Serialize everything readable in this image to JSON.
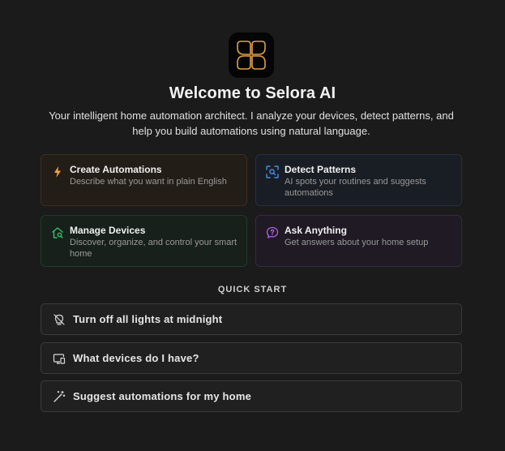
{
  "header": {
    "logo_icon": "flower-logo-icon",
    "title": "Welcome to Selora AI",
    "subtitle": "Your intelligent home automation architect. I analyze your devices, detect patterns, and help you build automations using natural language."
  },
  "features": [
    {
      "icon": "lightning-icon",
      "title": "Create Automations",
      "description": "Describe what you want in plain English",
      "accent": "#f0a040"
    },
    {
      "icon": "scan-search-icon",
      "title": "Detect Patterns",
      "description": "AI spots your routines and suggests automations",
      "accent": "#4a90e8"
    },
    {
      "icon": "home-search-icon",
      "title": "Manage Devices",
      "description": "Discover, organize, and control your smart home",
      "accent": "#34c26a"
    },
    {
      "icon": "chat-question-icon",
      "title": "Ask Anything",
      "description": "Get answers about your home setup",
      "accent": "#b060e0"
    }
  ],
  "quick_start": {
    "label": "QUICK START",
    "items": [
      {
        "icon": "lightbulb-off-icon",
        "label": "Turn off all lights at midnight"
      },
      {
        "icon": "devices-icon",
        "label": "What devices do I have?"
      },
      {
        "icon": "magic-wand-icon",
        "label": "Suggest automations for my home"
      }
    ]
  },
  "colors": {
    "background": "#1b1b1c",
    "logo_accent": "#e0a04a"
  }
}
